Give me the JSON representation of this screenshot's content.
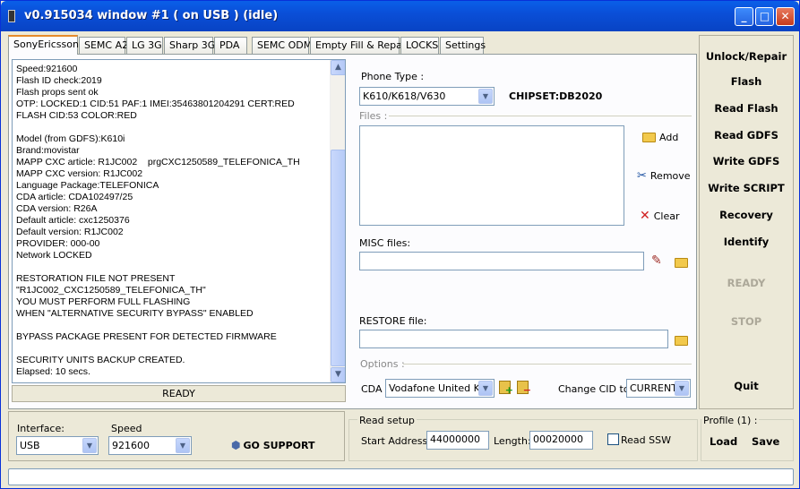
{
  "window": {
    "title": "v0.915034 window #1 ( on USB ) (idle)",
    "min": "_",
    "max": "□",
    "close": "✕"
  },
  "tabs": [
    "SonyEricsson",
    "SEMC A2",
    "LG 3G",
    "Sharp 3G",
    "PDA",
    "SEMC ODM",
    "Empty Fill & Repair",
    "LOCKS",
    "Settings"
  ],
  "log": {
    "lines": "Speed:921600\nFlash ID check:2019\nFlash props sent ok\nOTP: LOCKED:1 CID:51 PAF:1 IMEI:35463801204291 CERT:RED\nFLASH CID:53 COLOR:RED\n\nModel (from GDFS):K610i\nBrand:movistar\nMAPP CXC article: R1JC002    prgCXC1250589_TELEFONICA_TH\nMAPP CXC version: R1JC002\nLanguage Package:TELEFONICA\nCDA article: CDA102497/25\nCDA version: R26A\nDefault article: cxc1250376\nDefault version: R1JC002\nPROVIDER: 000-00\nNetwork LOCKED\n\nRESTORATION FILE NOT PRESENT\n\"R1JC002_CXC1250589_TELEFONICA_TH\"\nYOU MUST PERFORM FULL FLASHING\nWHEN \"ALTERNATIVE SECURITY BYPASS\" ENABLED\n\nBYPASS PACKAGE PRESENT FOR DETECTED FIRMWARE\n\nSECURITY UNITS BACKUP CREATED.\nElapsed: 10 secs.",
    "status": "READY"
  },
  "phone": {
    "type_label": "Phone Type :",
    "type_value": "K610/K618/V630",
    "chipset": "CHIPSET:DB2020"
  },
  "files": {
    "label": "Files :",
    "add": "Add",
    "remove": "Remove",
    "clear": "Clear"
  },
  "misc": {
    "label": "MISC files:",
    "value": ""
  },
  "restore": {
    "label": "RESTORE file:",
    "value": ""
  },
  "options": {
    "label": "Options :",
    "cda_label": "CDA",
    "cda_value": "Vodafone United Kin",
    "cid_label": "Change CID to",
    "cid_value": "CURRENT"
  },
  "actions": [
    "Unlock/Repair",
    "Flash",
    "Read Flash",
    "Read GDFS",
    "Write GDFS",
    "Write SCRIPT",
    "Recovery",
    "Identify"
  ],
  "status_buttons": {
    "ready": "READY",
    "stop": "STOP",
    "quit": "Quit"
  },
  "conn": {
    "interface_label": "Interface:",
    "interface_value": "USB",
    "speed_label": "Speed",
    "speed_value": "921600",
    "support": "GO SUPPORT"
  },
  "readsetup": {
    "label": "Read setup",
    "start_label": "Start Address:",
    "start_value": "44000000",
    "length_label": "Length:",
    "length_value": "00020000",
    "ssw_label": "Read SSW"
  },
  "profile": {
    "label": "Profile (1) :",
    "load": "Load",
    "save": "Save"
  }
}
